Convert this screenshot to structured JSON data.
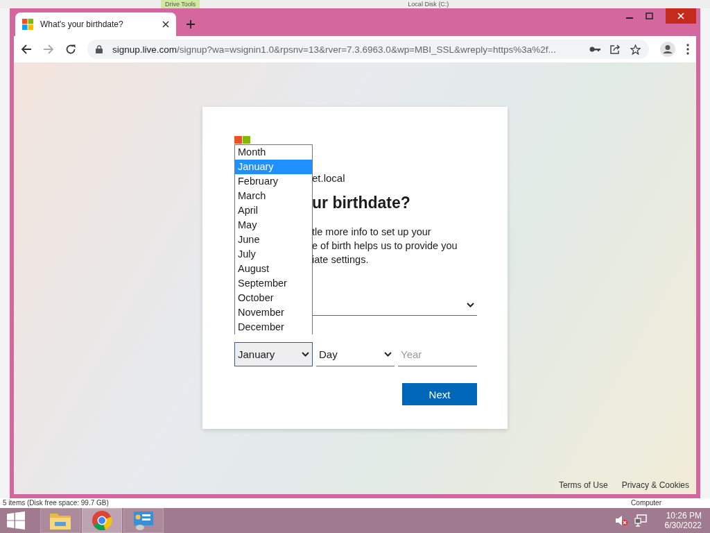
{
  "background_window": {
    "ribbon_tab": "Drive Tools",
    "title": "Local Disk (C:)",
    "status": "5 items (Disk free space: 99.7 GB)",
    "location": "Computer"
  },
  "browser": {
    "tab_title": "What's your birthdate?",
    "url_host": "signup.live.com",
    "url_path": "/signup?wa=wsignin1.0&rpsnv=13&rver=7.3.6963.0&wp=MBI_SSL&wreply=https%3a%2f..."
  },
  "card": {
    "account_partial": "et.local",
    "heading_partial": "ur birthdate?",
    "description_lines": [
      "tle more info to set up your",
      "e of birth helps us to provide you",
      "iate settings."
    ],
    "month_select": {
      "value": "January"
    },
    "day_select": {
      "placeholder": "Day"
    },
    "year_field": {
      "placeholder": "Year"
    },
    "next_button": "Next"
  },
  "month_dropdown": {
    "options": [
      {
        "label": "Month",
        "selected": false
      },
      {
        "label": "January",
        "selected": true
      },
      {
        "label": "February",
        "selected": false
      },
      {
        "label": "March",
        "selected": false
      },
      {
        "label": "April",
        "selected": false
      },
      {
        "label": "May",
        "selected": false
      },
      {
        "label": "June",
        "selected": false
      },
      {
        "label": "July",
        "selected": false
      },
      {
        "label": "August",
        "selected": false
      },
      {
        "label": "September",
        "selected": false
      },
      {
        "label": "October",
        "selected": false
      },
      {
        "label": "November",
        "selected": false
      },
      {
        "label": "December",
        "selected": false
      }
    ]
  },
  "footer_links": [
    "Terms of Use",
    "Privacy & Cookies"
  ],
  "taskbar": {
    "apps": [
      {
        "kind": "folder",
        "selected": false
      },
      {
        "kind": "browser",
        "selected": true
      },
      {
        "kind": "control-panel",
        "selected": false
      }
    ],
    "time": "10:26 PM",
    "date": "6/30/2022"
  }
}
